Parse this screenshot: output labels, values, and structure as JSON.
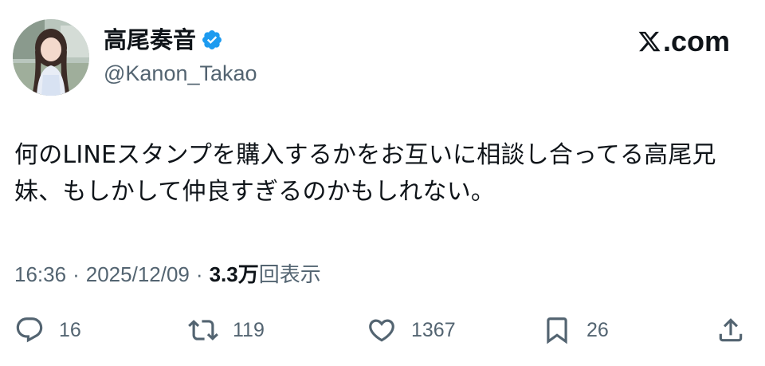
{
  "author": {
    "display_name": "高尾奏音",
    "handle": "@Kanon_Takao",
    "verified": true,
    "avatar_icon": "profile-photo"
  },
  "brand": {
    "label": ".com",
    "icon": "x-logo-icon"
  },
  "tweet": {
    "text": "何のLINEスタンプを購入するかをお互いに相談し合ってる高尾兄妹、もしかして仲良すぎるのかもしれない。"
  },
  "meta": {
    "time": "16:36",
    "separator": "·",
    "date": "2025/12/09",
    "views_count": "3.3万",
    "views_label": "回表示"
  },
  "actions": {
    "reply": {
      "icon": "reply-icon",
      "count": "16"
    },
    "repost": {
      "icon": "repost-icon",
      "count": "119"
    },
    "like": {
      "icon": "heart-icon",
      "count": "1367"
    },
    "bookmark": {
      "icon": "bookmark-icon",
      "count": "26"
    },
    "share": {
      "icon": "share-icon"
    }
  },
  "colors": {
    "text_primary": "#0f1419",
    "text_secondary": "#536471",
    "verified_blue": "#1d9bf0",
    "background": "#ffffff"
  }
}
